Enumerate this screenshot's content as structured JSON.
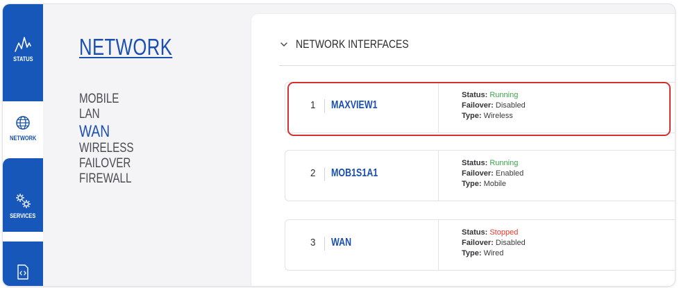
{
  "rail": {
    "status_label": "STATUS",
    "network_label": "NETWORK",
    "services_label": "SERVICES"
  },
  "subnav": {
    "title": "NETWORK",
    "items": [
      "MOBILE",
      "LAN",
      "WAN",
      "WIRELESS",
      "FAILOVER",
      "FIREWALL"
    ],
    "active": "WAN"
  },
  "section": {
    "title": "NETWORK INTERFACES"
  },
  "labels": {
    "status": "Status:",
    "failover": "Failover:",
    "type": "Type:"
  },
  "interfaces": [
    {
      "index": "1",
      "name": "MAXVIEW1",
      "status": "Running",
      "failover": "Disabled",
      "type": "Wireless"
    },
    {
      "index": "2",
      "name": "MOB1S1A1",
      "status": "Running",
      "failover": "Enabled",
      "type": "Mobile"
    },
    {
      "index": "3",
      "name": "WAN",
      "status": "Stopped",
      "failover": "Disabled",
      "type": "Wired"
    }
  ],
  "colors": {
    "brand_blue": "#1757b9",
    "running": "#3aa34a",
    "stopped": "#e2372d",
    "highlight": "#d32f2f"
  },
  "icons": [
    "activity-icon",
    "globe-icon",
    "gears-icon",
    "code-file-icon",
    "chevron-down-icon"
  ]
}
